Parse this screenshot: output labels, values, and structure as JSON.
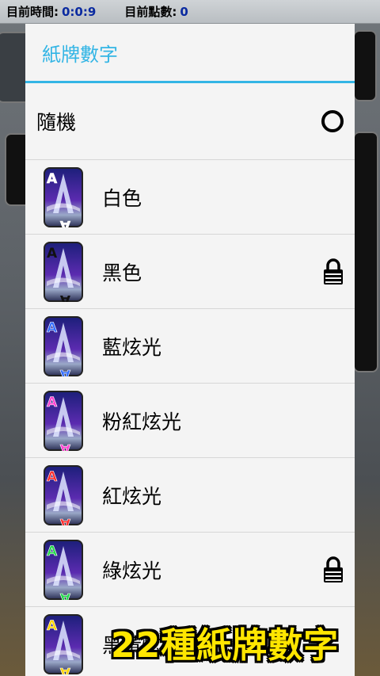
{
  "status_bar": {
    "time_label": "目前時間:",
    "time_value": "0:0:9",
    "score_label": "目前點數:",
    "score_value": "0"
  },
  "dialog": {
    "title": "紙牌數字",
    "accent_color": "#33b5e5",
    "random_option": {
      "label": "隨機",
      "selected": true
    },
    "options": [
      {
        "label": "白色",
        "glow_color": "#ffffff",
        "locked": false,
        "icon": "card-ace-white-icon"
      },
      {
        "label": "黑色",
        "glow_color": "#000000",
        "locked": true,
        "icon": "card-ace-black-icon"
      },
      {
        "label": "藍炫光",
        "glow_color": "#2f6bff",
        "locked": false,
        "icon": "card-ace-blue-glow-icon"
      },
      {
        "label": "粉紅炫光",
        "glow_color": "#ff3fd0",
        "locked": false,
        "icon": "card-ace-pink-glow-icon"
      },
      {
        "label": "紅炫光",
        "glow_color": "#ff2a2a",
        "locked": false,
        "icon": "card-ace-red-glow-icon"
      },
      {
        "label": "綠炫光",
        "glow_color": "#22d84a",
        "locked": true,
        "icon": "card-ace-green-glow-icon"
      },
      {
        "label": "黑黃炫光",
        "glow_color": "#ffd400",
        "locked": false,
        "icon": "card-ace-yellow-glow-icon"
      }
    ]
  },
  "promo_text": "22種紙牌數字"
}
